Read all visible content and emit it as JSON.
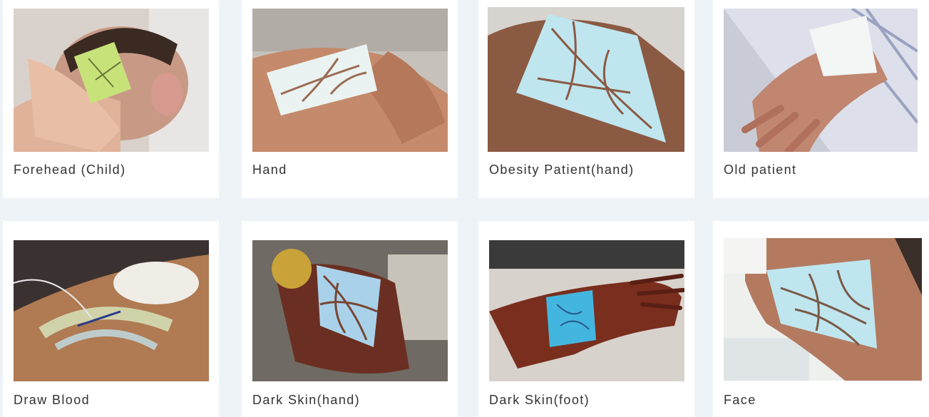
{
  "gallery": {
    "items": [
      {
        "caption": "Forehead (Child)",
        "subject": "forehead-child"
      },
      {
        "caption": "Hand",
        "subject": "hand"
      },
      {
        "caption": "Obesity Patient(hand)",
        "subject": "obesity-hand"
      },
      {
        "caption": "Old patient",
        "subject": "old-patient-hand"
      },
      {
        "caption": "Draw Blood",
        "subject": "draw-blood-arm"
      },
      {
        "caption": "Dark Skin(hand)",
        "subject": "dark-skin-hand"
      },
      {
        "caption": "Dark Skin(foot)",
        "subject": "dark-skin-foot"
      },
      {
        "caption": "Face",
        "subject": "face-neck"
      }
    ]
  },
  "colors": {
    "page_background": "#eef3f8",
    "card_background": "#ffffff",
    "caption_text": "#333333",
    "vein_projection": "#bfe6ef"
  }
}
